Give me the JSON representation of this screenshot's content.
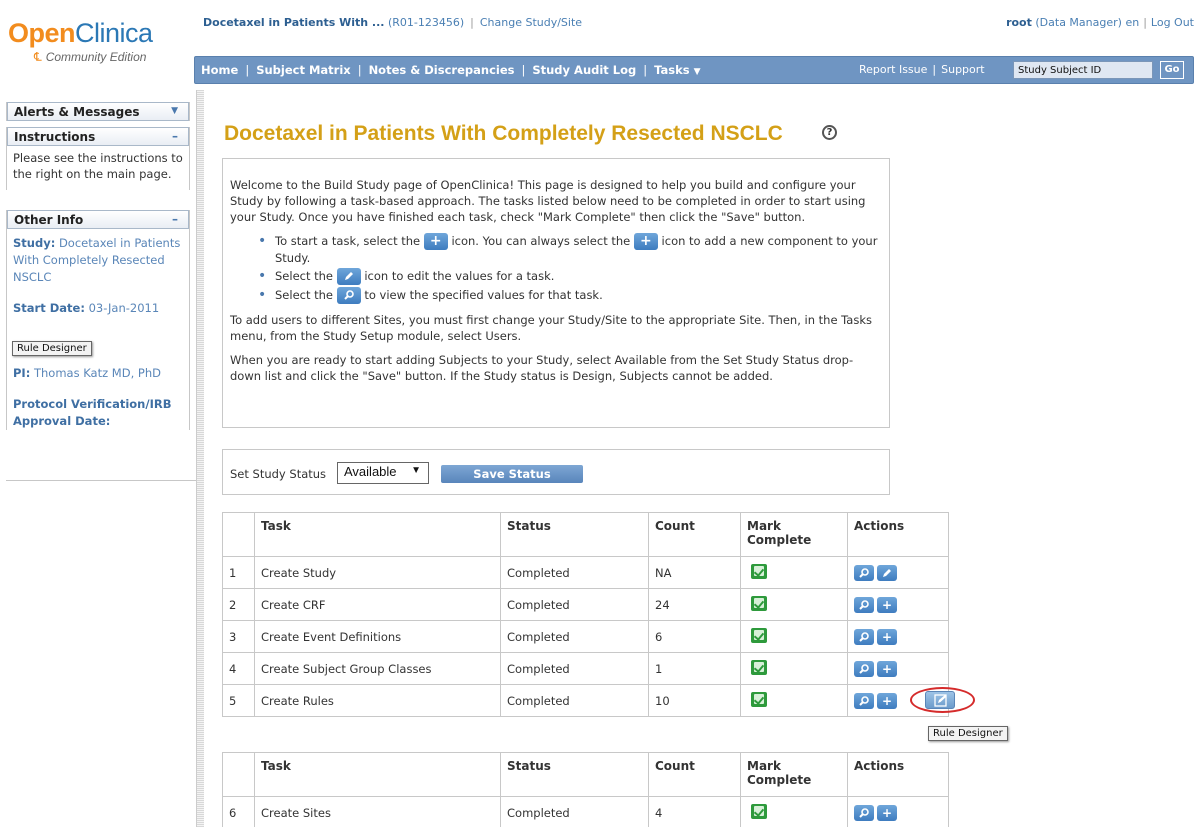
{
  "logo": {
    "brand_a": "Open",
    "brand_b": "Clinica",
    "edition": "Community Edition"
  },
  "header": {
    "study_name": "Docetaxel in Patients With ...",
    "protocol": "(R01-123456)",
    "change_study": "Change Study/Site",
    "user": "root",
    "role": "(Data Manager)",
    "lang": "en",
    "logout": "Log Out"
  },
  "nav": {
    "home": "Home",
    "subject_matrix": "Subject Matrix",
    "notes": "Notes & Discrepancies",
    "audit_log": "Study Audit Log",
    "tasks": "Tasks",
    "report_issue": "Report Issue",
    "support": "Support",
    "search_value": "Study Subject ID",
    "go": "Go"
  },
  "sidebar": {
    "alerts": "Alerts & Messages",
    "instructions_title": "Instructions",
    "instructions_text": "Please see the instructions to the right on the main page.",
    "other_info_title": "Other Info",
    "study_label": "Study:",
    "study_value": "Docetaxel in Patients With Completely Resected NSCLC",
    "start_label": "Start Date:",
    "start_value": "03-Jan-2011",
    "tooltip": "Rule Designer",
    "pi_label": "PI:",
    "pi_value": "Thomas Katz MD, PhD",
    "protocol_label": "Protocol Verification/IRB Approval Date:"
  },
  "main": {
    "title": "Docetaxel in Patients With Completely Resected NSCLC",
    "intro_p1": "Welcome to the Build Study page of OpenClinica! This page is designed to help you build and configure your Study by following a task-based approach. The tasks listed below need to be completed in order to start using your Study. Once you have finished each task, check \"Mark Complete\" then click the \"Save\" button.",
    "bullet1_a": "To start a task, select the",
    "bullet1_b": "icon. You can always select the",
    "bullet1_c": "icon to add a new component to your Study.",
    "bullet2_a": "Select the",
    "bullet2_b": "icon to edit the values for a task.",
    "bullet3_a": "Select the",
    "bullet3_b": "to view the specified values for that task.",
    "intro_p2": "To add users to different Sites, you must first change your Study/Site to the appropriate Site. Then, in the Tasks menu, from the Study Setup module, select Users.",
    "intro_p3": "When you are ready to start adding Subjects to your Study, select Available from the Set Study Status drop-down list and click the \"Save\" button. If the Study status is Design, Subjects cannot be added.",
    "status_label": "Set Study Status",
    "status_value": "Available",
    "save_status": "Save Status",
    "rule_designer_tooltip": "Rule Designer"
  },
  "table_headers": {
    "task": "Task",
    "status": "Status",
    "count": "Count",
    "mark_complete": "Mark Complete",
    "actions": "Actions"
  },
  "tasks_table1": [
    {
      "num": "1",
      "task": "Create Study",
      "status": "Completed",
      "count": "NA"
    },
    {
      "num": "2",
      "task": "Create CRF",
      "status": "Completed",
      "count": "24"
    },
    {
      "num": "3",
      "task": "Create Event Definitions",
      "status": "Completed",
      "count": "6"
    },
    {
      "num": "4",
      "task": "Create Subject Group Classes",
      "status": "Completed",
      "count": "1"
    },
    {
      "num": "5",
      "task": "Create Rules",
      "status": "Completed",
      "count": "10"
    }
  ],
  "tasks_table2": [
    {
      "num": "6",
      "task": "Create Sites",
      "status": "Completed",
      "count": "4"
    }
  ]
}
